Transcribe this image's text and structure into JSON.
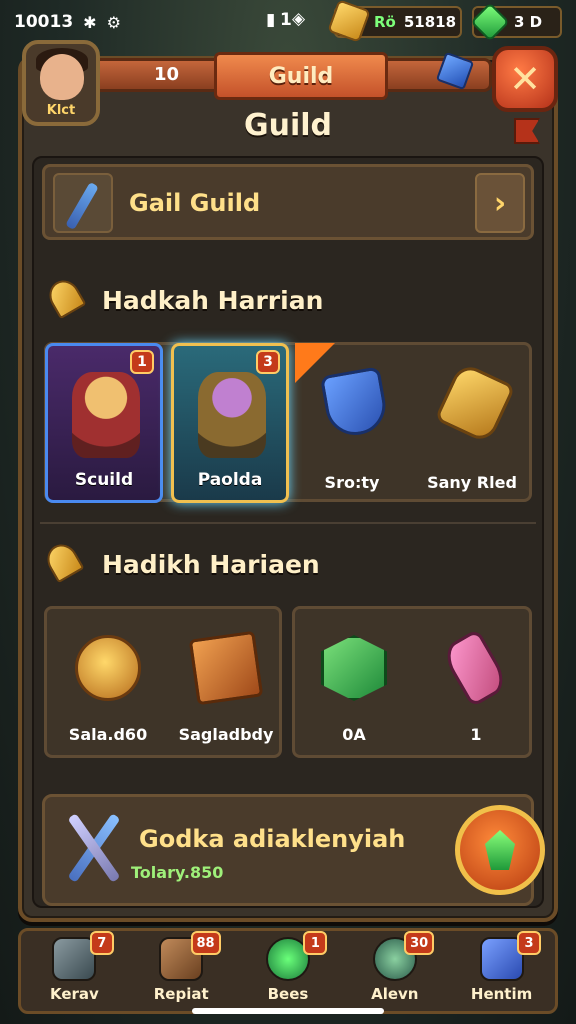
{
  "status_bar": {
    "time": "10013",
    "right_text": "1"
  },
  "resources": {
    "gold_prefix": "Rö",
    "gold_value": "51818",
    "gems_value": "3 D"
  },
  "header": {
    "level": "10",
    "ribbon_title": "Guild",
    "avatar_tag": "Klct"
  },
  "page_title": "Guild",
  "guild": {
    "name": "Gail Guild"
  },
  "section1": {
    "title": "Hadkah Harrian",
    "heroes": [
      {
        "label": "Scuild",
        "badge": "1"
      },
      {
        "label": "Paolda",
        "badge": "3"
      }
    ],
    "items": [
      {
        "label": "Sro:ty"
      },
      {
        "label": "Sany Rled"
      }
    ]
  },
  "section2": {
    "title": "Hadikh Hariaen",
    "items": [
      {
        "label": "Sala.d60"
      },
      {
        "label": "Sagladbdy"
      },
      {
        "label": "0A"
      },
      {
        "label": "1"
      }
    ]
  },
  "quest": {
    "title": "Godka adiaklenyiah",
    "subtitle": "Tolary.850"
  },
  "nav": [
    {
      "label": "Kerav",
      "badge": "7"
    },
    {
      "label": "Repiat",
      "badge": "88"
    },
    {
      "label": "Bees",
      "badge": "1"
    },
    {
      "label": "Alevn",
      "badge": "30"
    },
    {
      "label": "Hentim",
      "badge": "3"
    }
  ],
  "colors": {
    "accent": "#f0c04a",
    "panel": "#3a332a",
    "ribbon": "#f08a4d",
    "positive": "#9ff07a"
  }
}
